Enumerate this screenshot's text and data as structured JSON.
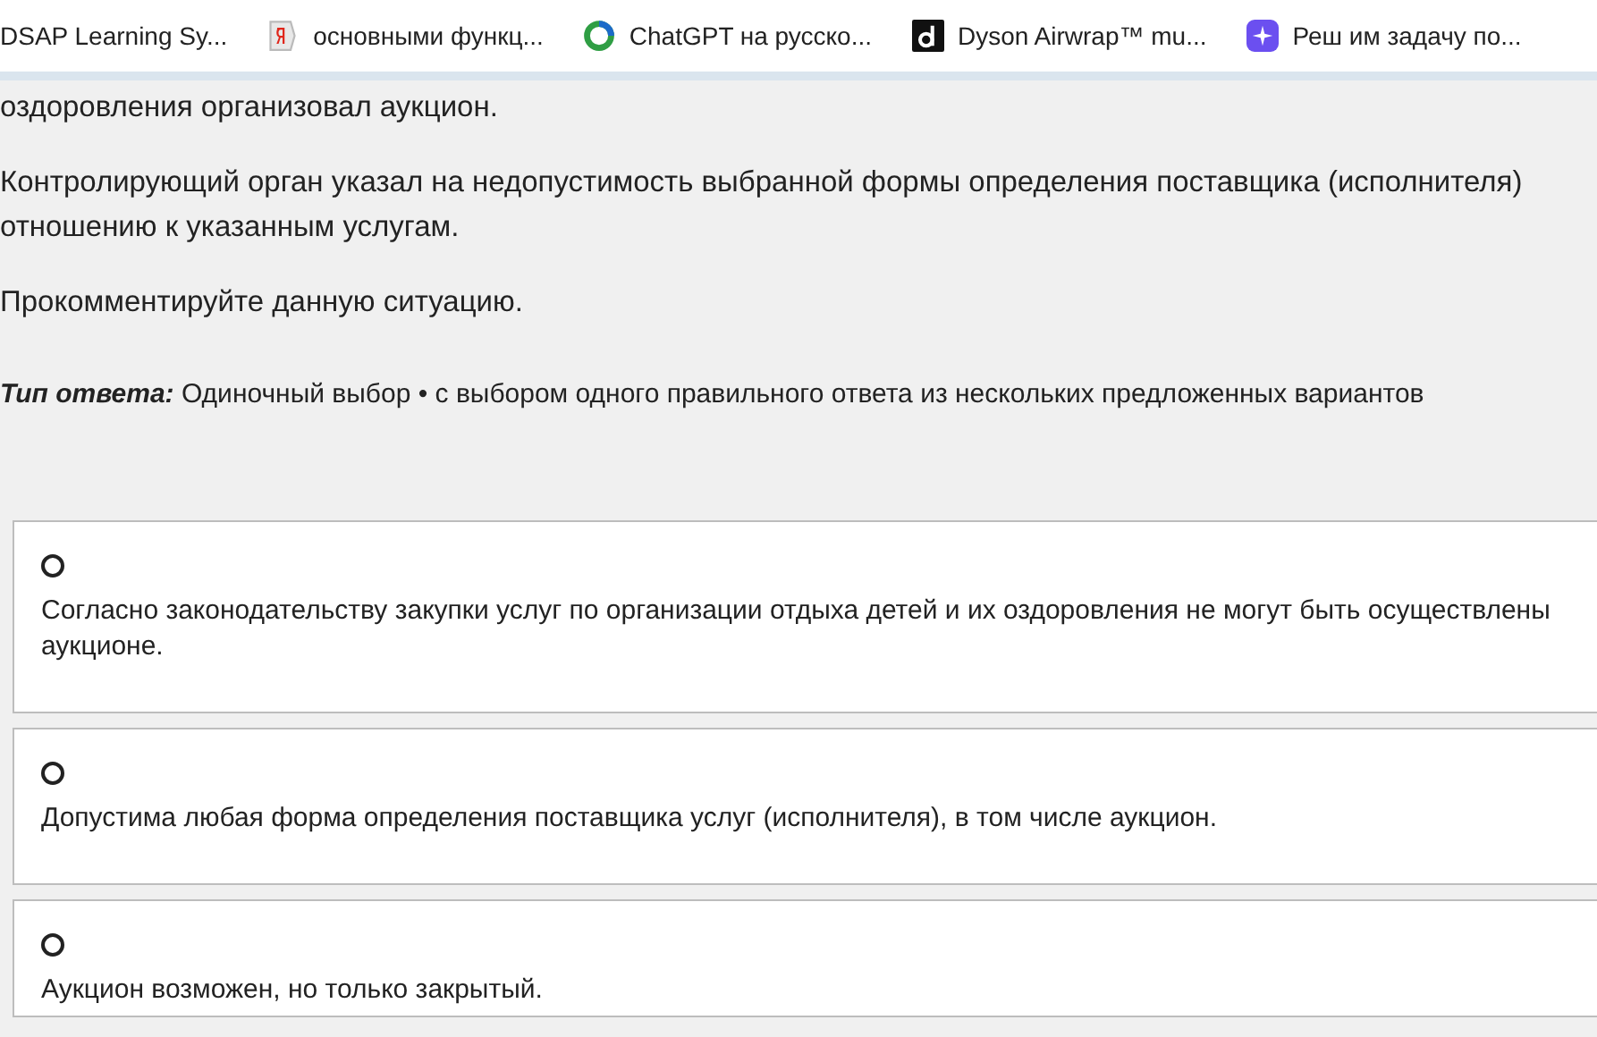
{
  "bookmarks": [
    {
      "label": "DSAP Learning Sy...",
      "kind": "plain"
    },
    {
      "label": "основными функц...",
      "kind": "yandex"
    },
    {
      "label": "ChatGPT на русско...",
      "kind": "ring"
    },
    {
      "label": "Dyson Airwrap™ mu...",
      "kind": "dark"
    },
    {
      "label": "Реш им задачу по...",
      "kind": "sparkle"
    }
  ],
  "question": {
    "paragraphs": [
      "оздоровления организовал аукцион.",
      "Контролирующий орган указал на недопустимость выбранной формы определения поставщика (исполнителя)\nотношению к указанным услугам.",
      "Прокомментируйте данную ситуацию."
    ],
    "answer_type_label": "Тип ответа:",
    "answer_type": "Одиночный выбор • с выбором одного правильного ответа из нескольких предложенных вариантов"
  },
  "options": [
    {
      "text": "Согласно законодательству закупки услуг по организации отдыха детей и их оздоровления не могут быть осуществлены\nаукционе.",
      "selected": false
    },
    {
      "text": "Допустима любая форма определения поставщика услуг (исполнителя), в том числе аукцион.",
      "selected": false
    },
    {
      "text": "Аукцион возможен, но только закрытый.",
      "selected": false
    }
  ]
}
